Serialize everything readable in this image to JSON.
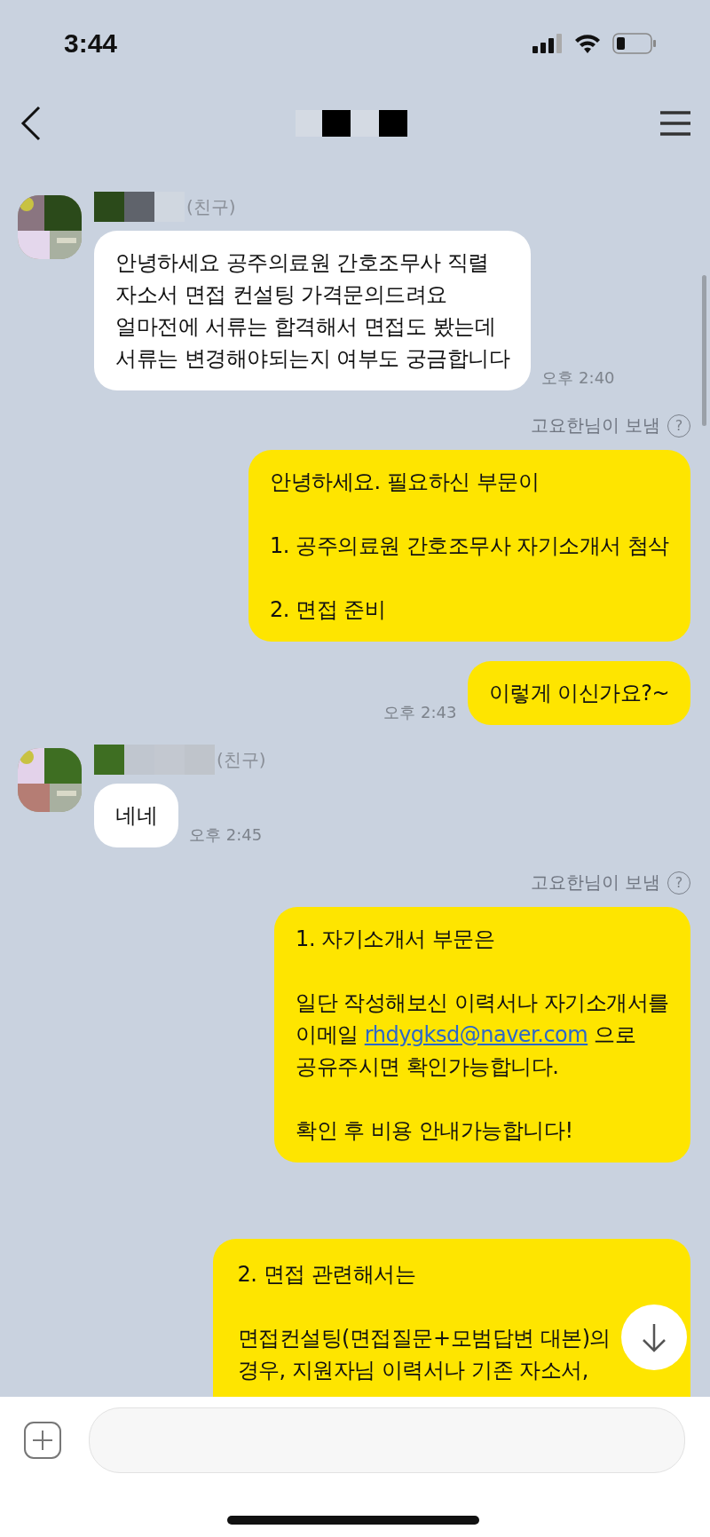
{
  "status_bar": {
    "time": "3:44"
  },
  "groups": [
    {
      "kind": "received",
      "sender": "(친구)",
      "time": "오후 2:40",
      "bubbles": [
        {
          "paragraphs": [
            {
              "text": "안녕하세요 공주의료원 간호조무사 직렬\n자소서 면접 컨설팅 가격문의드려요\n얼마전에 서류는 합격해서 면접도 봤는데\n서류는 변경해야되는지 여부도 궁금합니다"
            }
          ]
        }
      ]
    },
    {
      "kind": "sent",
      "sent_by": "고요한님이 보냄",
      "help": "?",
      "time": "오후 2:43",
      "bubbles": [
        {
          "paragraphs": [
            {
              "text": "안녕하세요. 필요하신 부문이"
            },
            {
              "text": "1. 공주의료원 간호조무사 자기소개서 첨삭"
            },
            {
              "text": "2. 면접 준비"
            }
          ]
        },
        {
          "paragraphs": [
            {
              "text": "이렇게 이신가요?~"
            }
          ]
        }
      ]
    },
    {
      "kind": "received",
      "sender": "(친구)",
      "time": "오후 2:45",
      "bubbles": [
        {
          "paragraphs": [
            {
              "text": "네네"
            }
          ]
        }
      ]
    },
    {
      "kind": "sent",
      "sent_by": "고요한님이 보냄",
      "help": "?",
      "bubbles": [
        {
          "paragraphs": [
            {
              "text": "1. 자기소개서 부문은"
            },
            {
              "text": "일단 작성해보신 이력서나 자기소개서를\n이메일 ",
              "link": "rhdygksd@naver.com",
              "after": " 으로\n공유주시면 확인가능합니다."
            },
            {
              "text": "확인 후 비용 안내가능합니다!"
            }
          ]
        }
      ]
    },
    {
      "kind": "sent",
      "bubbles": [
        {
          "paragraphs": [
            {
              "text": "2. 면접 관련해서는"
            },
            {
              "text": "면접컨설팅(면접질문+모범답변 대본)의\n경우, 지원자님 이력서나 기존 자소서,"
            }
          ]
        }
      ]
    }
  ]
}
